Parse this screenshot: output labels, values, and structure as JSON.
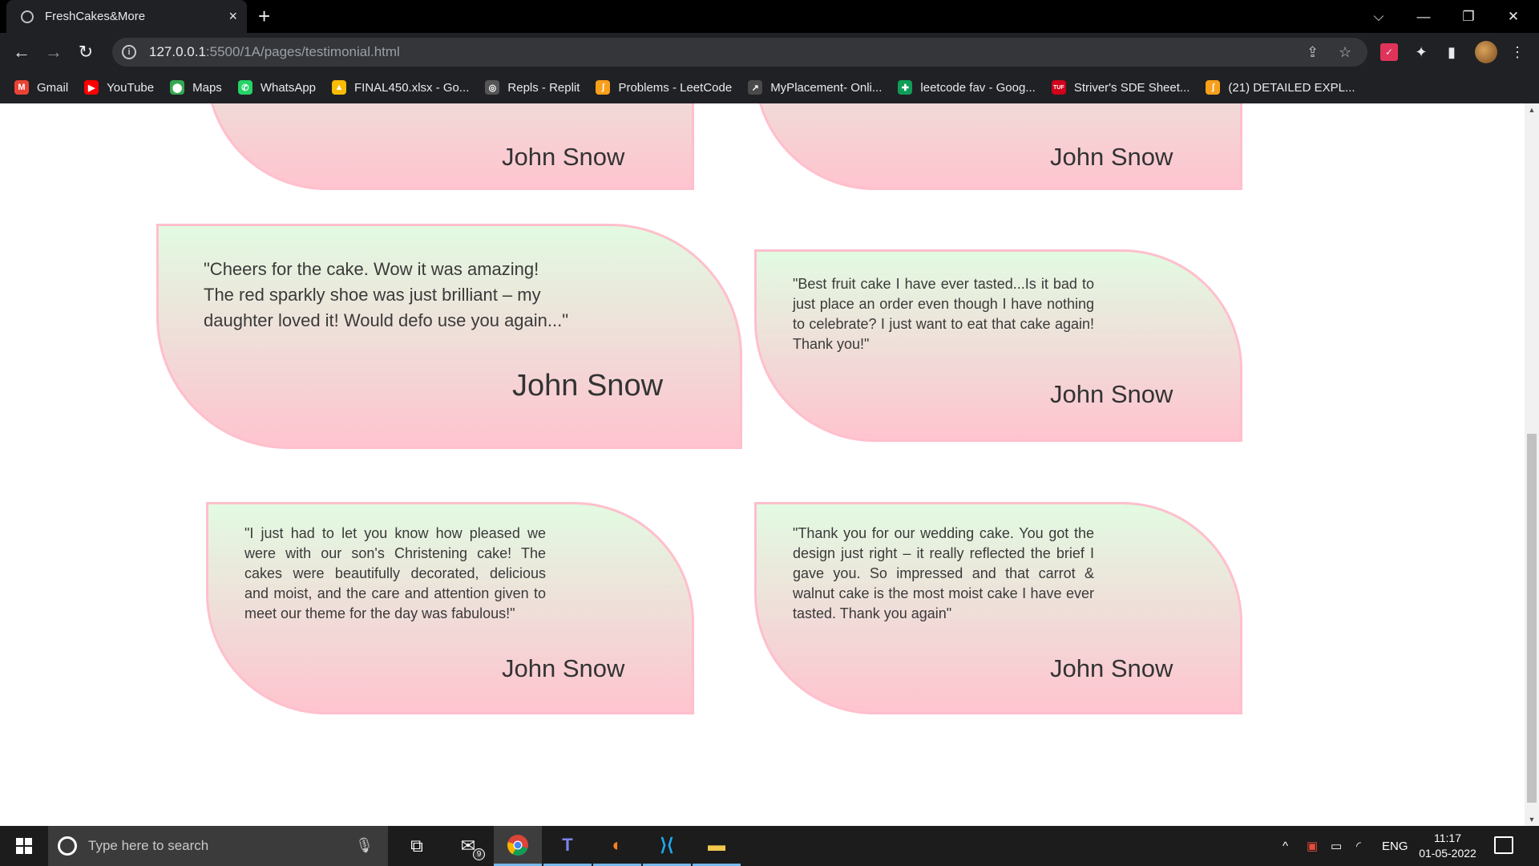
{
  "browser": {
    "tab_title": "FreshCakes&More",
    "tab_close": "×",
    "new_tab": "+",
    "window_controls": {
      "dropdown": "⌵",
      "minimize": "—",
      "restore": "❐",
      "close": "✕"
    },
    "url_host": "127.0.0.1",
    "url_rest": ":5500/1A/pages/testimonial.html",
    "bookmarks": [
      {
        "label": "Gmail",
        "icon": "gmail-icon",
        "color": "#ea4335",
        "glyph": "M"
      },
      {
        "label": "YouTube",
        "icon": "youtube-icon",
        "color": "#ff0000",
        "glyph": "▶"
      },
      {
        "label": "Maps",
        "icon": "maps-icon",
        "color": "#34a853",
        "glyph": "⬤"
      },
      {
        "label": "WhatsApp",
        "icon": "whatsapp-icon",
        "color": "#25d366",
        "glyph": "✆"
      },
      {
        "label": "FINAL450.xlsx - Go...",
        "icon": "google-drive-icon",
        "color": "#fbbc04",
        "glyph": "▲"
      },
      {
        "label": "Repls - Replit",
        "icon": "replit-icon",
        "color": "#555555",
        "glyph": "◎"
      },
      {
        "label": "Problems - LeetCode",
        "icon": "leetcode-icon",
        "color": "#f89f1b",
        "glyph": "ʃ"
      },
      {
        "label": "MyPlacement- Onli...",
        "icon": "external-link-icon",
        "color": "#4a4a4a",
        "glyph": "↗"
      },
      {
        "label": "leetcode fav - Goog...",
        "icon": "google-sheets-icon",
        "color": "#0f9d58",
        "glyph": "✚"
      },
      {
        "label": "Striver's SDE Sheet...",
        "icon": "tuf-icon",
        "color": "#d0021b",
        "glyph": "TUF"
      },
      {
        "label": "(21) DETAILED EXPL...",
        "icon": "leetcode-icon",
        "color": "#f89f1b",
        "glyph": "ʃ"
      }
    ]
  },
  "testimonials": [
    {
      "quote": "",
      "author": "John Snow"
    },
    {
      "quote": "",
      "author": "John Snow"
    },
    {
      "quote": "\"Cheers for the cake. Wow it was amazing! The red sparkly shoe was just brilliant – my daughter loved it! Would defo use you again...\"",
      "author": "John Snow"
    },
    {
      "quote": "\"Best fruit cake I have ever tasted...Is it bad to just place an order even though I have nothing to celebrate? I just want to eat that cake again! Thank you!\"",
      "author": "John Snow"
    },
    {
      "quote": "\"I just had to let you know how pleased we were with our son's Christening cake! The cakes were beautifully decorated, delicious and moist, and the care and attention given to meet our theme for the day was fabulous!\"",
      "author": "John Snow"
    },
    {
      "quote": "\"Thank you for our wedding cake. You got the design just right – it really reflected the brief I gave you. So impressed and that carrot & walnut cake is the most moist cake I have ever tasted. Thank you again\"",
      "author": "John Snow"
    }
  ],
  "taskbar": {
    "search_placeholder": "Type here to search",
    "mail_badge": "9",
    "language": "ENG",
    "time": "11:17",
    "date": "01-05-2022"
  },
  "colors": {
    "card_border": "#ffbfcc",
    "card_top": "#e2fbe2",
    "card_bottom": "#ffc4cf",
    "chrome_dark": "#202124",
    "taskbar_accent": "#76b9ed"
  }
}
